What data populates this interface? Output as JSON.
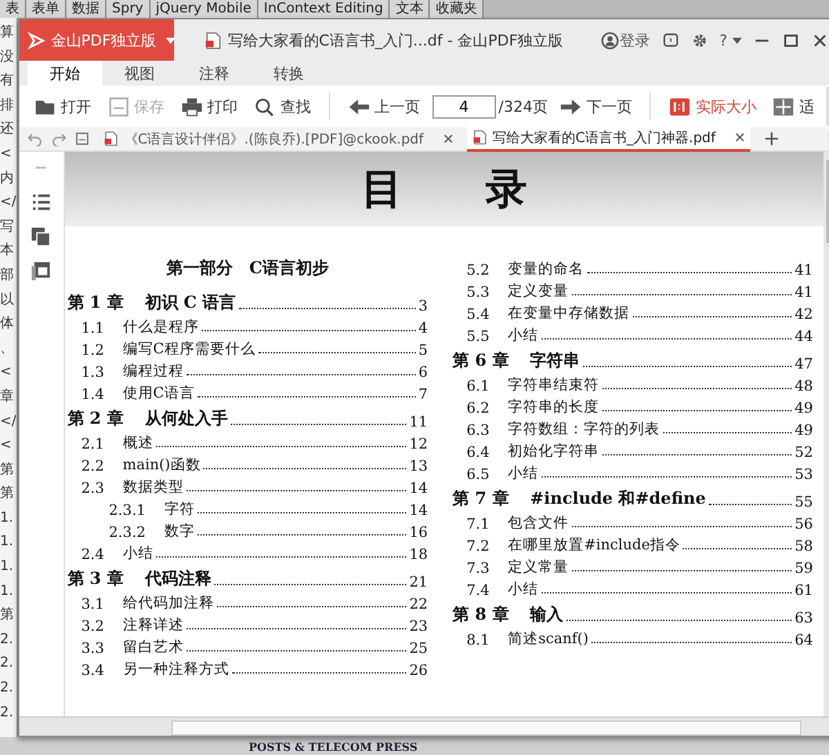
{
  "background_app": {
    "menu": [
      "表",
      "表单",
      "数据",
      "Spry",
      "jQuery Mobile",
      "InContext Editing",
      "文本",
      "收藏夹"
    ],
    "code_lines": [
      "算",
      "没",
      "有",
      "排",
      "还",
      "<",
      "内",
      "</",
      "写",
      "本",
      "部",
      "以",
      "体",
      "、",
      "<",
      "章",
      "</",
      "<",
      "第",
      "第",
      "1.",
      "1.",
      "1.",
      "1.",
      "第",
      "2.",
      "2.",
      "2.",
      "2."
    ],
    "footer": "POSTS & TELECOM PRESS"
  },
  "window": {
    "brand": "金山PDF独立版",
    "title": "写给大家看的C语言书_入门...df - 金山PDF独立版",
    "login": "登录",
    "help": "?"
  },
  "ribbon_tabs": [
    {
      "label": "开始",
      "selected": true
    },
    {
      "label": "视图",
      "selected": false
    },
    {
      "label": "注释",
      "selected": false
    },
    {
      "label": "转换",
      "selected": false
    }
  ],
  "toolbar": {
    "file_actions": [
      {
        "kind": "open",
        "label": "打开",
        "disabled": false
      },
      {
        "kind": "save",
        "label": "保存",
        "disabled": true
      },
      {
        "kind": "print",
        "label": "打印",
        "disabled": false
      },
      {
        "kind": "find",
        "label": "查找",
        "disabled": false
      }
    ],
    "prev": "上一页",
    "page": "4",
    "page_total": "/324页",
    "next": "下一页",
    "actual_size": "实际大小",
    "fit": "适"
  },
  "doc_tabs": [
    {
      "label": "《C语言设计伴侣》.(陈良乔).[PDF]@ckook.pdf",
      "selected": false
    },
    {
      "label": "写给大家看的C语言书_入门神器.pdf",
      "selected": true
    }
  ],
  "toc": {
    "heading": "目　　录",
    "columns": [
      [
        {
          "kind": "part",
          "number": "第一部分",
          "title": "C语言初步"
        },
        {
          "kind": "chapter",
          "number": "第 1 章",
          "title": "初识 C 语言",
          "page": "3"
        },
        {
          "kind": "section",
          "number": "1.1",
          "title": "什么是程序",
          "page": "4"
        },
        {
          "kind": "section",
          "number": "1.2",
          "title": "编写C程序需要什么",
          "page": "5"
        },
        {
          "kind": "section",
          "number": "1.3",
          "title": "编程过程",
          "page": "6"
        },
        {
          "kind": "section",
          "number": "1.4",
          "title": "使用C语言",
          "page": "7"
        },
        {
          "kind": "chapter",
          "number": "第 2 章",
          "title": "从何处入手",
          "page": "11"
        },
        {
          "kind": "section",
          "number": "2.1",
          "title": "概述",
          "page": "12"
        },
        {
          "kind": "section",
          "number": "2.2",
          "title": "main()函数",
          "page": "13"
        },
        {
          "kind": "section",
          "number": "2.3",
          "title": "数据类型",
          "page": "14"
        },
        {
          "kind": "subsection",
          "number": "2.3.1",
          "title": "字符",
          "page": "14"
        },
        {
          "kind": "subsection",
          "number": "2.3.2",
          "title": "数字",
          "page": "16"
        },
        {
          "kind": "section",
          "number": "2.4",
          "title": "小结",
          "page": "18"
        },
        {
          "kind": "chapter",
          "number": "第 3 章",
          "title": "代码注释",
          "page": "21"
        },
        {
          "kind": "section",
          "number": "3.1",
          "title": "给代码加注释",
          "page": "22"
        },
        {
          "kind": "section",
          "number": "3.2",
          "title": "注释详述",
          "page": "23"
        },
        {
          "kind": "section",
          "number": "3.3",
          "title": "留白艺术",
          "page": "25"
        },
        {
          "kind": "section",
          "number": "3.4",
          "title": "另一种注释方式",
          "page": "26"
        }
      ],
      [
        {
          "kind": "section",
          "number": "5.2",
          "title": "变量的命名",
          "page": "41"
        },
        {
          "kind": "section",
          "number": "5.3",
          "title": "定义变量",
          "page": "41"
        },
        {
          "kind": "section",
          "number": "5.4",
          "title": "在变量中存储数据",
          "page": "42"
        },
        {
          "kind": "section",
          "number": "5.5",
          "title": "小结",
          "page": "44"
        },
        {
          "kind": "chapter",
          "number": "第 6 章",
          "title": "字符串",
          "page": "47"
        },
        {
          "kind": "section",
          "number": "6.1",
          "title": "字符串结束符",
          "page": "48"
        },
        {
          "kind": "section",
          "number": "6.2",
          "title": "字符串的长度",
          "page": "49"
        },
        {
          "kind": "section",
          "number": "6.3",
          "title": "字符数组：字符的列表",
          "page": "49"
        },
        {
          "kind": "section",
          "number": "6.4",
          "title": "初始化字符串",
          "page": "52"
        },
        {
          "kind": "section",
          "number": "6.5",
          "title": "小结",
          "page": "53"
        },
        {
          "kind": "chapter",
          "number": "第 7 章",
          "title": "#include 和#define",
          "page": "55"
        },
        {
          "kind": "section",
          "number": "7.1",
          "title": "包含文件",
          "page": "56"
        },
        {
          "kind": "section",
          "number": "7.2",
          "title": "在哪里放置#include指令",
          "page": "58"
        },
        {
          "kind": "section",
          "number": "7.3",
          "title": "定义常量",
          "page": "59"
        },
        {
          "kind": "section",
          "number": "7.4",
          "title": "小结",
          "page": "61"
        },
        {
          "kind": "chapter",
          "number": "第 8 章",
          "title": "输入",
          "page": "63"
        },
        {
          "kind": "section",
          "number": "8.1",
          "title": "简述scanf()",
          "page": "64"
        }
      ]
    ]
  }
}
